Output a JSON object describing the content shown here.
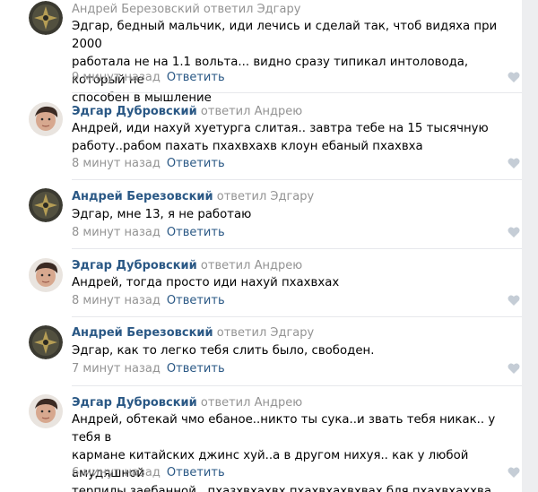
{
  "colors": {
    "author_link": "#2a5885",
    "muted": "#939393",
    "text": "#000000",
    "page_bg": "#edeef0",
    "card_bg": "#ffffff",
    "like_icon": "#c5cdd6"
  },
  "comments": [
    {
      "author": "",
      "replied_to": "Андрей Березовский ответил Эдгару",
      "text": "Эдгар, бедный мальчик, иди лечись и сделай так, чтоб видяха при 2000\nработала не на 1.1 вольта... видно сразу типикал интоловода, который не\nспособен в мышление",
      "time": "9 минут назад",
      "reply": "Ответить",
      "avatar_icon": "dark-emblem-avatar"
    },
    {
      "author": "Эдгар Дубровский",
      "replied_to": "ответил Андрею",
      "text": "Андрей, иди нахуй хуетурга слитая.. завтра тебе на 15 тысячную\nработу..рабом пахать пхахвхахв клоун ебаный пхахвха",
      "time": "8 минут назад",
      "reply": "Ответить",
      "avatar_icon": "person-photo-avatar"
    },
    {
      "author": "Андрей Березовский",
      "replied_to": "ответил Эдгару",
      "text": "Эдгар, мне 13, я не работаю",
      "time": "8 минут назад",
      "reply": "Ответить",
      "avatar_icon": "dark-emblem-avatar"
    },
    {
      "author": "Эдгар Дубровский",
      "replied_to": "ответил Андрею",
      "text": "Андрей, тогда просто иди нахуй пхахвхах",
      "time": "8 минут назад",
      "reply": "Ответить",
      "avatar_icon": "person-photo-avatar"
    },
    {
      "author": "Андрей Березовский",
      "replied_to": "ответил Эдгару",
      "text": "Эдгар, как то легко тебя слить было, свободен.",
      "time": "7 минут назад",
      "reply": "Ответить",
      "avatar_icon": "dark-emblem-avatar"
    },
    {
      "author": "Эдгар Дубровский",
      "replied_to": "ответил Андрею",
      "text": "Андрей, обтекай чмо ебаное..никто ты сука..и звать тебя никак.. у тебя в\nкармане китайских джинс хуй..а в другом нихуя.. как у любой амудяшной\nтерпилы заебанной.. пхазхвхахвх пхахвхахвхвах бля пхахвхаххва",
      "time": "6 минут назад",
      "reply": "Ответить",
      "avatar_icon": "person-photo-avatar"
    }
  ]
}
